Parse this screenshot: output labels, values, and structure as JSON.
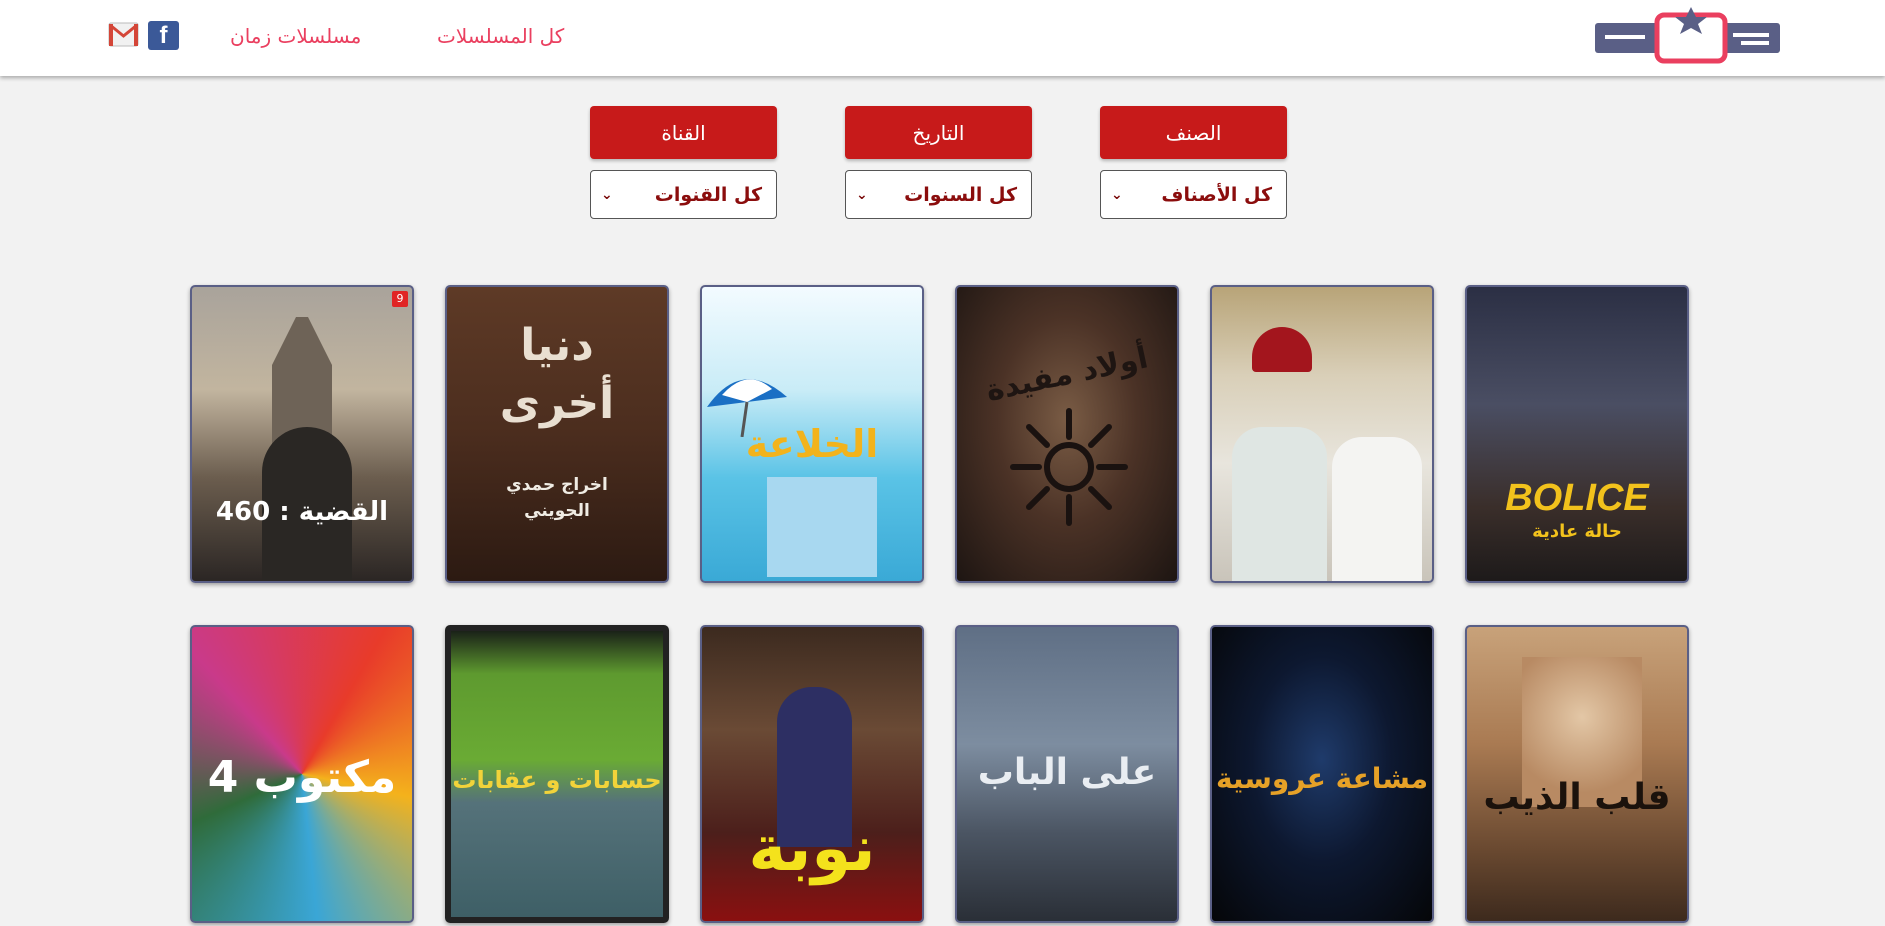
{
  "header": {
    "logo_alt": "تونسي",
    "nav": {
      "all_series": "كل المسلسلات",
      "old_series": "مسلسلات زمان"
    },
    "facebook_letter": "f"
  },
  "filters": {
    "genre": {
      "label": "الصنف",
      "value": "كل الأصناف"
    },
    "date": {
      "label": "التاريخ",
      "value": "كل السنوات"
    },
    "channel": {
      "label": "القناة",
      "value": "كل القنوات"
    }
  },
  "posters": {
    "row1": [
      {
        "title": "BOLICE",
        "subtitle": "حالة عادية"
      },
      {
        "title": ""
      },
      {
        "title": "أولاد مفيدة"
      },
      {
        "title": "الخلاعة"
      },
      {
        "title": "دنيا أخرى",
        "subtitle": "اخراج حمدي الجويني"
      },
      {
        "title": "القضية : 460",
        "badge": "9"
      }
    ],
    "row2": [
      {
        "title": "قلب الذيب"
      },
      {
        "title": "مشاعة عروسية"
      },
      {
        "title": "على الباب"
      },
      {
        "title": "نوبة"
      },
      {
        "title": "حسابات و عقابات"
      },
      {
        "title": "مكتوب 4"
      }
    ]
  },
  "colors": {
    "accent": "#c71a1a",
    "nav": "#ea3f5f",
    "card_border": "#5a5f86"
  }
}
